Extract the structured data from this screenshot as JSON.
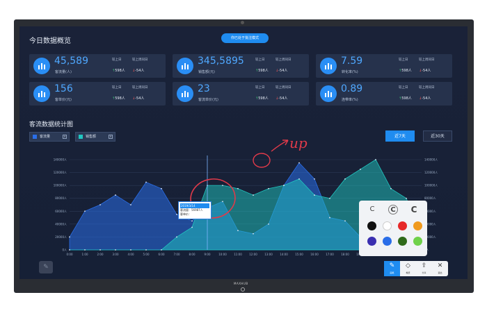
{
  "header": {
    "title": "今日数据概览",
    "mode_button": "你已处于批注模式"
  },
  "cards": [
    {
      "value": "45,589",
      "label": "客流量(人)",
      "h1": "较上日",
      "h2": "较上周同日",
      "d1": "598人",
      "d2": "-54人",
      "icon": "building-chart-icon"
    },
    {
      "value": "345,5895",
      "label": "销售额(元)",
      "h1": "较上日",
      "h2": "较上周同日",
      "d1": "598人",
      "d2": "-54人",
      "icon": "bar-chart-icon"
    },
    {
      "value": "7.59",
      "label": "转化率(%)",
      "h1": "较上日",
      "h2": "较上周同日",
      "d1": "598人",
      "d2": "-54人",
      "icon": "swap-arrows-icon"
    },
    {
      "value": "156",
      "label": "客单价(元)",
      "h1": "较上日",
      "h2": "较上周同日",
      "d1": "598人",
      "d2": "-54人",
      "icon": "user-settings-icon"
    },
    {
      "value": "23",
      "label": "客流单价(元)",
      "h1": "较上日",
      "h2": "较上周同日",
      "d1": "598人",
      "d2": "-54人",
      "icon": "receipt-icon"
    },
    {
      "value": "0.89",
      "label": "连带率(%)",
      "h1": "较上日",
      "h2": "较上周同日",
      "d1": "598人",
      "d2": "-54人",
      "icon": "checkbox-icon"
    }
  ],
  "chart_section": {
    "title": "客流数据统计图",
    "legend": [
      {
        "name": "客流量",
        "color": "#2a6ee8"
      },
      {
        "name": "销售额",
        "color": "#20c6c0"
      }
    ],
    "range_buttons": [
      "近7天",
      "近30天"
    ],
    "active_range": "近7天"
  },
  "tooltip": {
    "date": "2019/3/14",
    "row1": "客流量：56987人",
    "row2": "客单价："
  },
  "annotation": {
    "text": "up"
  },
  "palette": {
    "pens": [
      "C",
      "C",
      "C"
    ],
    "colors": [
      "#111111",
      "#ffffff",
      "#e62828",
      "#f09a1e",
      "#3a2fb0",
      "#2a6ee8",
      "#2f6a1a",
      "#6fd14a"
    ]
  },
  "toolbar": {
    "items": [
      "画笔",
      "橡皮",
      "分享",
      "退出"
    ]
  },
  "chart_data": {
    "type": "area",
    "x": [
      "0:00",
      "1:00",
      "2:00",
      "3:00",
      "4:00",
      "5:00",
      "6:00",
      "7:00",
      "8:00",
      "9:00",
      "10:00",
      "11:00",
      "12:00",
      "13:00",
      "14:00",
      "15:00",
      "16:00",
      "17:00",
      "18:00",
      "19:00",
      "20:00",
      "21:00",
      "22:00",
      "23:00"
    ],
    "ylim": [
      0,
      140000
    ],
    "yticks": [
      "0人",
      "20000人",
      "40000人",
      "60000人",
      "80000人",
      "100000人",
      "120000人",
      "140000人"
    ],
    "series": [
      {
        "name": "客流量",
        "values": [
          20000,
          60000,
          70000,
          85000,
          70000,
          105000,
          95000,
          55000,
          45000,
          65000,
          75000,
          30000,
          25000,
          40000,
          100000,
          135000,
          110000,
          50000,
          45000,
          20000,
          20000,
          20000,
          20000,
          20000
        ]
      },
      {
        "name": "销售额",
        "values": [
          0,
          0,
          0,
          0,
          0,
          0,
          0,
          20000,
          35000,
          100000,
          100000,
          95000,
          85000,
          95000,
          100000,
          110000,
          85000,
          80000,
          110000,
          125000,
          140000,
          95000,
          80000,
          20000
        ]
      }
    ]
  }
}
